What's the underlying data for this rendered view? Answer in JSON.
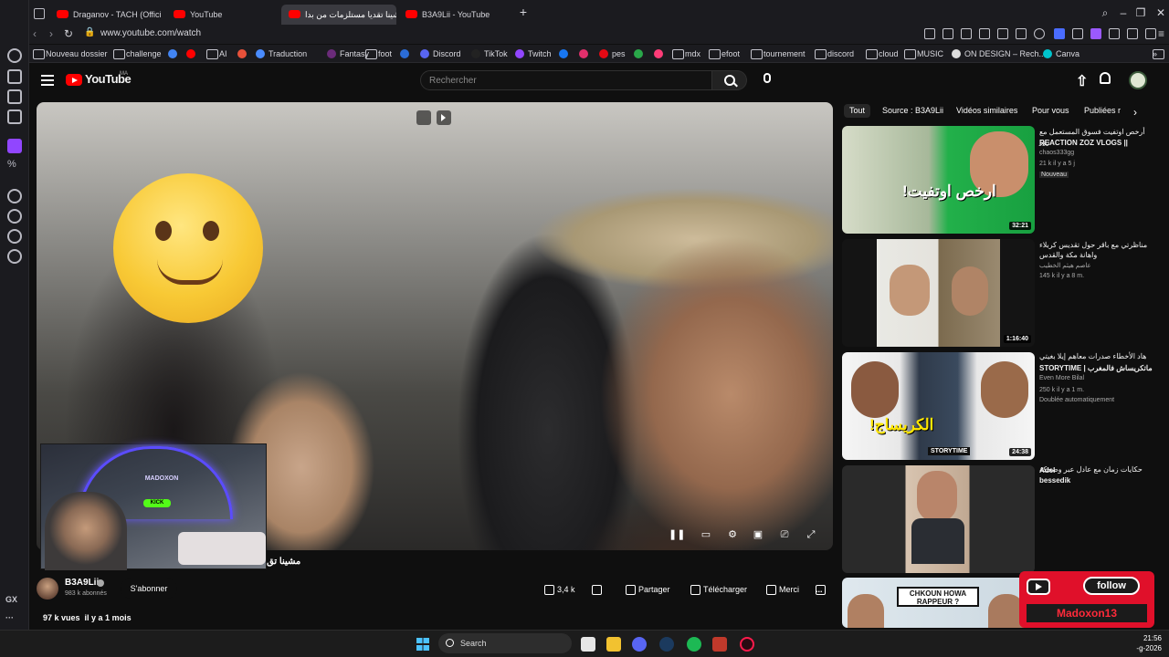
{
  "tabs": [
    {
      "label": "Draganov - TACH (Official"
    },
    {
      "label": "YouTube"
    },
    {
      "label": "مشينا تقديا مستلزمات من بدا"
    },
    {
      "label": "B3A9Lii - YouTube"
    }
  ],
  "address": {
    "url": "www.youtube.com/watch"
  },
  "bookmarks": [
    {
      "label": "Nouveau dossier"
    },
    {
      "label": "challenge"
    },
    {
      "label": "AI"
    },
    {
      "label": "Traduction"
    },
    {
      "label": "Fantasy"
    },
    {
      "label": "foot"
    },
    {
      "label": "Discord"
    },
    {
      "label": "TikTok"
    },
    {
      "label": "Twitch"
    },
    {
      "label": "pes"
    },
    {
      "label": "mdx"
    },
    {
      "label": "efoot"
    },
    {
      "label": "tournement"
    },
    {
      "label": "discord"
    },
    {
      "label": "cloud"
    },
    {
      "label": "MUSIC"
    },
    {
      "label": "ON DESIGN – Rech..."
    },
    {
      "label": "Canva"
    }
  ],
  "youtube": {
    "logo_text": "YouTube",
    "region": "MA",
    "search_placeholder": "Rechercher"
  },
  "opera_side": {
    "gx_label": "GX"
  },
  "overlay": {
    "cam_logo": "MADOXON",
    "cam_kick": "KICK",
    "follow_label": "follow",
    "follow_name": "Madoxon13"
  },
  "video": {
    "title": "مشينا تق",
    "channel_name": "B3A9Lii",
    "channel_subs": "983 k abonnés",
    "subscribe_label": "S'abonner",
    "likes": "3,4 k",
    "share_label": "Partager",
    "download_label": "Télécharger",
    "thanks_label": "Merci",
    "more_label": "...",
    "views": "97 k vues",
    "age": "il y a 1 mois"
  },
  "chips": [
    {
      "label": "Tout"
    },
    {
      "label": "Source : B3A9Lii"
    },
    {
      "label": "Vidéos similaires"
    },
    {
      "label": "Pour vous"
    },
    {
      "label": "Publiées r"
    }
  ],
  "recommendations": [
    {
      "title_ar": "أرخص اوتفيت فسوق المستعمل مع زوز",
      "title": "REACTION ZOZ VLOGS ||",
      "channel": "chaos333gg",
      "stats": "21 k  il y a 5 j",
      "badge": "Nouveau",
      "duration": "32:21",
      "thumb_text": "ارخص اوتفيت!"
    },
    {
      "title_ar": "مناظرتي مع باقر حول تقديس كربلاء واهانة مكة والقدس",
      "title": "",
      "channel": "عاصم هيثم الخطيب",
      "stats": "145 k  il y a 8 m.",
      "badge": "",
      "duration": "1:16:40",
      "thumb_text": ""
    },
    {
      "title_ar": "هاد الأخطاء صدرات معاهم إيلا بغيتي",
      "title": "STORYTIME | ماتكريساش فالمغرب",
      "channel": "Even More Bilal",
      "stats": "250 k  il y a 1 m.",
      "badge": "Doublée automatiquement",
      "duration": "24:38",
      "thumb_text": "الكريساج!"
    },
    {
      "title_ar": "حكايات زمان مع عادل عبر وضحكة",
      "title": "Adel bessedik",
      "channel": "",
      "stats": "",
      "badge": "",
      "duration": "",
      "thumb_text": ""
    },
    {
      "title_ar": "",
      "title": "",
      "channel": "",
      "stats": "",
      "badge": "",
      "duration": "",
      "thumb_text": "CHKOUN HOWA RAPPEUR ?"
    }
  ],
  "taskbar": {
    "search_label": "Search",
    "time": "21:56",
    "date": "-g-2026"
  }
}
